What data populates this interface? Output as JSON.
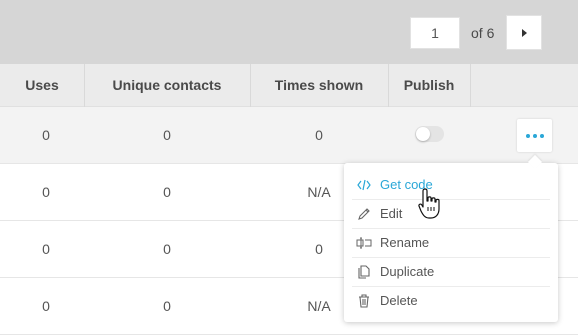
{
  "pagination": {
    "current_page": "1",
    "of_label": "of 6",
    "next_icon": "chevron-right-icon"
  },
  "table": {
    "columns": [
      "Uses",
      "Unique contacts",
      "Times shown",
      "Publish"
    ],
    "rows": [
      {
        "uses": "0",
        "unique_contacts": "0",
        "times_shown": "0",
        "publish": "off"
      },
      {
        "uses": "0",
        "unique_contacts": "0",
        "times_shown": "N/A"
      },
      {
        "uses": "0",
        "unique_contacts": "0",
        "times_shown": "0"
      },
      {
        "uses": "0",
        "unique_contacts": "0",
        "times_shown": "N/A"
      }
    ]
  },
  "row_actions": {
    "more_icon": "more-horizontal-icon"
  },
  "context_menu": {
    "items": [
      {
        "label": "Get code",
        "icon": "code-icon",
        "active": true
      },
      {
        "label": "Edit",
        "icon": "pencil-icon"
      },
      {
        "label": "Rename",
        "icon": "rename-icon"
      },
      {
        "label": "Duplicate",
        "icon": "duplicate-icon"
      },
      {
        "label": "Delete",
        "icon": "trash-icon"
      }
    ]
  },
  "colors": {
    "accent": "#2aa7d7",
    "header_bg": "#ebebeb",
    "topbar_bg": "#d6d6d6"
  }
}
